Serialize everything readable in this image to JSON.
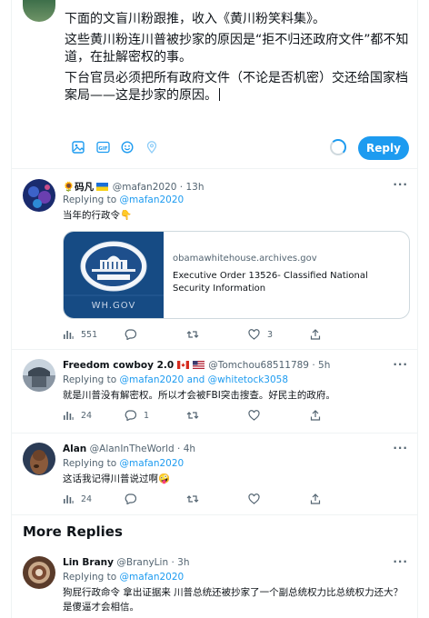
{
  "compose": {
    "lines": [
      "下面的文盲川粉跟推，收入《黄川粉笑料集》。",
      "这些黄川粉连川普被抄家的原因是“拒不归还政府文件”都不知道，在扯解密权的事。",
      "下台官员必须把所有政府文件（不论是否机密）交还给国家档案局——这是抄家的原因。"
    ],
    "reply_label": "Reply",
    "toolbar_icons": [
      "image-icon",
      "gif-icon",
      "emoji-icon",
      "location-icon"
    ]
  },
  "tweets": [
    {
      "name": "🌻码凡",
      "handle": "@mafan2020",
      "time": "13h",
      "replying_prefix": "Replying to",
      "replying_to": "@mafan2020",
      "replying_join": "",
      "replying_to2": "",
      "text": "当年的行政令👇",
      "card": {
        "image_caption": "WH.GOV",
        "domain": "obamawhitehouse.archives.gov",
        "title": "Executive Order 13526- Classified National Security Information"
      },
      "views": "551",
      "replies": "",
      "retweets": "",
      "likes": "3"
    },
    {
      "name": "Freedom cowboy 2.0",
      "handle": "@Tomchou68511789",
      "time": "5h",
      "replying_prefix": "Replying to",
      "replying_to": "@mafan2020",
      "replying_join": "and",
      "replying_to2": "@whitetock3058",
      "text": "就是川普没有解密权。所以才会被FBI突击搜查。好民主的政府。",
      "views": "24",
      "replies": "1",
      "retweets": "",
      "likes": ""
    },
    {
      "name": "Alan",
      "handle": "@AlanInTheWorld",
      "time": "4h",
      "replying_prefix": "Replying to",
      "replying_to": "@mafan2020",
      "replying_join": "",
      "replying_to2": "",
      "text": "这话我记得川普说过啊🤪",
      "views": "24",
      "replies": "",
      "retweets": "",
      "likes": ""
    },
    {
      "name": "Lin Brany",
      "handle": "@BranyLin",
      "time": "3h",
      "replying_prefix": "Replying to",
      "replying_to": "@mafan2020",
      "replying_join": "",
      "replying_to2": "",
      "text": "狗屁行政命令 拿出证据来 川普总统还被抄家了一个副总统权力比总统权力还大？是傻逼才会相信。"
    }
  ],
  "more_replies_label": "More Replies",
  "colors": {
    "accent": "#1d9bf0",
    "secondary_text": "#536471",
    "border": "#eff3f4"
  }
}
